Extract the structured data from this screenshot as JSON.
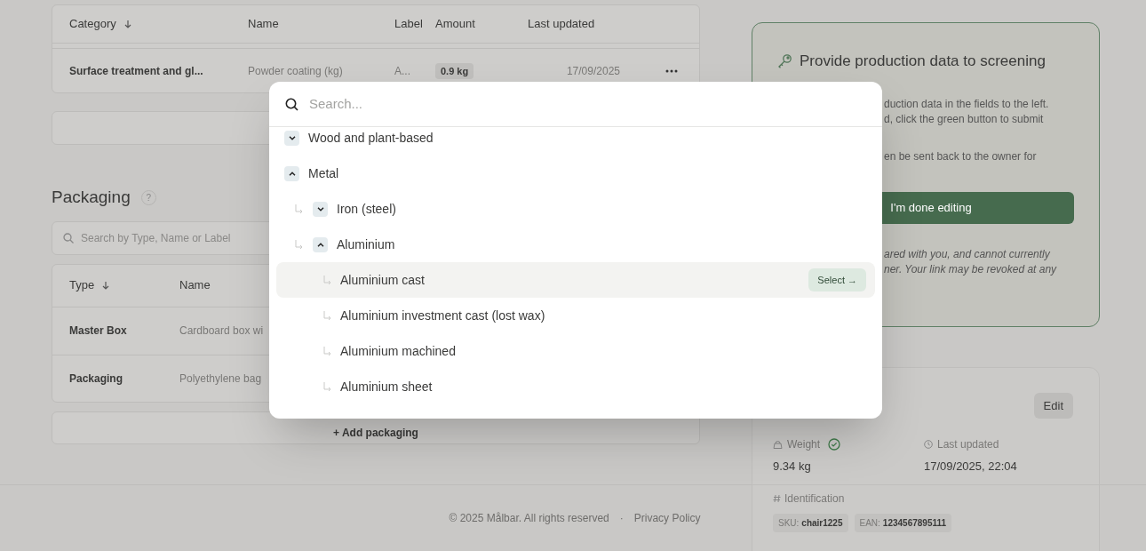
{
  "materials_table": {
    "columns": [
      {
        "label": "Category",
        "sorted": true
      },
      {
        "label": "Name",
        "sorted": false
      },
      {
        "label": "Label",
        "sorted": false
      },
      {
        "label": "Amount",
        "sorted": false
      },
      {
        "label": "Last updated",
        "sorted": false
      }
    ],
    "rows": [
      {
        "category": "Surface treatment and gl...",
        "name": "Powder coating (kg)",
        "label": "A...",
        "amount": "0.9 kg",
        "last_updated": "17/09/2025"
      }
    ]
  },
  "packaging": {
    "title": "Packaging",
    "help": "?",
    "search": {
      "placeholder": "Search by Type, Name or Label"
    },
    "table": {
      "columns": [
        {
          "label": "Type",
          "sorted": true
        },
        {
          "label": "Name",
          "sorted": false
        }
      ],
      "rows": [
        {
          "type": "Master Box",
          "name": "Cardboard box wi"
        },
        {
          "type": "Packaging",
          "name": "Polyethylene bag"
        }
      ]
    },
    "add_button": "+ Add packaging"
  },
  "screening_card": {
    "title": "Provide production data to screening",
    "paragraphs": [
      [
        "duction data in the fields to the left.",
        "d, click the green button to submit"
      ],
      [
        "en be sent back to the owner for"
      ]
    ],
    "button": "I'm done editing",
    "note_lines": [
      "ared with you, and cannot currently",
      "ner. Your link may be revoked at any"
    ]
  },
  "product_card": {
    "edit_button": "Edit",
    "weight": {
      "label": "Weight",
      "value": "9.34 kg",
      "verified": true
    },
    "last_updated": {
      "label": "Last updated",
      "value": "17/09/2025, 22:04"
    },
    "identification": {
      "label": "Identification",
      "codes": [
        {
          "label": "SKU:",
          "value": "chair1225"
        },
        {
          "label": "EAN:",
          "value": "1234567895111"
        }
      ]
    }
  },
  "footer": {
    "copyright": "© 2025 Målbar. All rights reserved",
    "separator": "·",
    "link": "Privacy Policy"
  },
  "picker": {
    "search": {
      "placeholder": "Search..."
    },
    "tree": [
      {
        "label": "Wood and plant-based",
        "expanded": false
      },
      {
        "label": "Metal",
        "expanded": true,
        "children": [
          {
            "label": "Iron (steel)",
            "expanded": false
          },
          {
            "label": "Aluminium",
            "expanded": true,
            "children": [
              {
                "label": "Aluminium cast",
                "highlighted": true,
                "action": "Select →"
              },
              {
                "label": "Aluminium investment cast (lost wax)",
                "highlighted": false
              },
              {
                "label": "Aluminium machined",
                "highlighted": false
              },
              {
                "label": "Aluminium sheet",
                "highlighted": false
              }
            ]
          }
        ]
      }
    ]
  }
}
